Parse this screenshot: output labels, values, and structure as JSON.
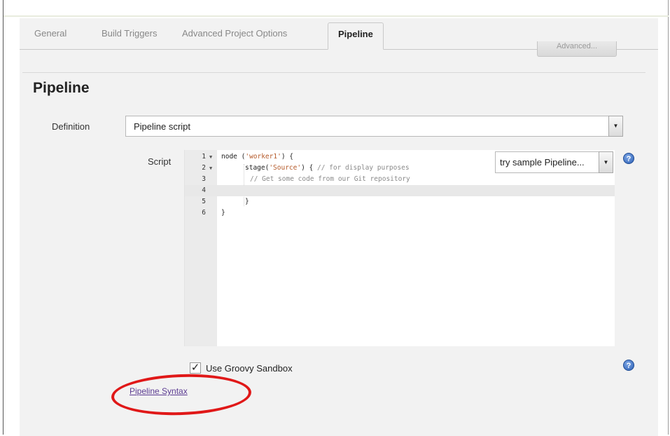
{
  "tabs": [
    {
      "label": "General",
      "active": false
    },
    {
      "label": "Build Triggers",
      "active": false
    },
    {
      "label": "Advanced Project Options",
      "active": false
    },
    {
      "label": "Pipeline",
      "active": true
    }
  ],
  "advanced_button": {
    "label": "Advanced..."
  },
  "section": {
    "title": "Pipeline"
  },
  "definition": {
    "label": "Definition",
    "selected": "Pipeline script"
  },
  "script": {
    "label": "Script",
    "lines": [
      {
        "num": "1",
        "fold": true,
        "text": "node ('worker1') {"
      },
      {
        "num": "2",
        "fold": true,
        "text": "stage('Source') { // for display purposes"
      },
      {
        "num": "3",
        "fold": false,
        "text": "// Get some code from our Git repository"
      },
      {
        "num": "4",
        "fold": false,
        "text": ""
      },
      {
        "num": "5",
        "fold": false,
        "text": "}"
      },
      {
        "num": "6",
        "fold": false,
        "text": "}"
      }
    ],
    "active_line": 4,
    "sample_select": "try sample Pipeline..."
  },
  "sandbox": {
    "label": "Use Groovy Sandbox",
    "checked": true
  },
  "links": {
    "pipeline_syntax": "Pipeline Syntax"
  },
  "annotation": {
    "color": "#e01818",
    "shape": "ellipse"
  },
  "colors": {
    "link": "#5c3c92",
    "help_icon": "#2b5fb5",
    "string": "#b55a2a",
    "comment": "#8a8a8a"
  },
  "icons": {
    "help": "help-icon",
    "dropdown": "dropdown-arrow-icon",
    "fold": "fold-arrow-icon",
    "check": "checkmark-icon"
  }
}
